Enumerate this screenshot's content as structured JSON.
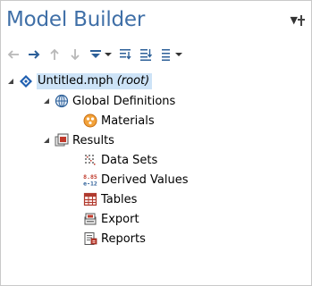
{
  "panel": {
    "title": "Model Builder",
    "menu_arrow": "▼"
  },
  "toolbar": {
    "buttons": [
      {
        "name": "go-back",
        "icon": "left-arrow-icon"
      },
      {
        "name": "go-forward",
        "icon": "right-arrow-icon"
      },
      {
        "name": "move-up",
        "icon": "up-arrow-icon"
      },
      {
        "name": "move-down",
        "icon": "down-arrow-icon"
      },
      {
        "name": "show",
        "icon": "show-icon"
      },
      {
        "name": "expand-sections",
        "icon": "expand-sections-icon"
      },
      {
        "name": "collapse-sections",
        "icon": "collapse-sections-icon"
      },
      {
        "name": "tree-options",
        "icon": "list-icon"
      }
    ]
  },
  "tree": {
    "root": {
      "label": "Untitled.mph",
      "suffix": "(root)",
      "icon": "comsol-model-icon",
      "expanded": true
    },
    "global_definitions": {
      "label": "Global Definitions",
      "icon": "globe-icon",
      "expanded": true
    },
    "materials": {
      "label": "Materials",
      "icon": "materials-icon"
    },
    "results": {
      "label": "Results",
      "icon": "results-icon",
      "expanded": true
    },
    "data_sets": {
      "label": "Data Sets",
      "icon": "data-sets-icon"
    },
    "derived_values": {
      "label": "Derived Values",
      "icon": "derived-values-icon",
      "icon_text_top": "8.85",
      "icon_text_bottom": "e-12"
    },
    "tables": {
      "label": "Tables",
      "icon": "table-icon"
    },
    "export": {
      "label": "Export",
      "icon": "export-icon"
    },
    "reports": {
      "label": "Reports",
      "icon": "reports-icon"
    }
  },
  "colors": {
    "title": "#3f6fa7",
    "toolbar_icon": "#2c5f98",
    "selection": "#cde3f7"
  }
}
